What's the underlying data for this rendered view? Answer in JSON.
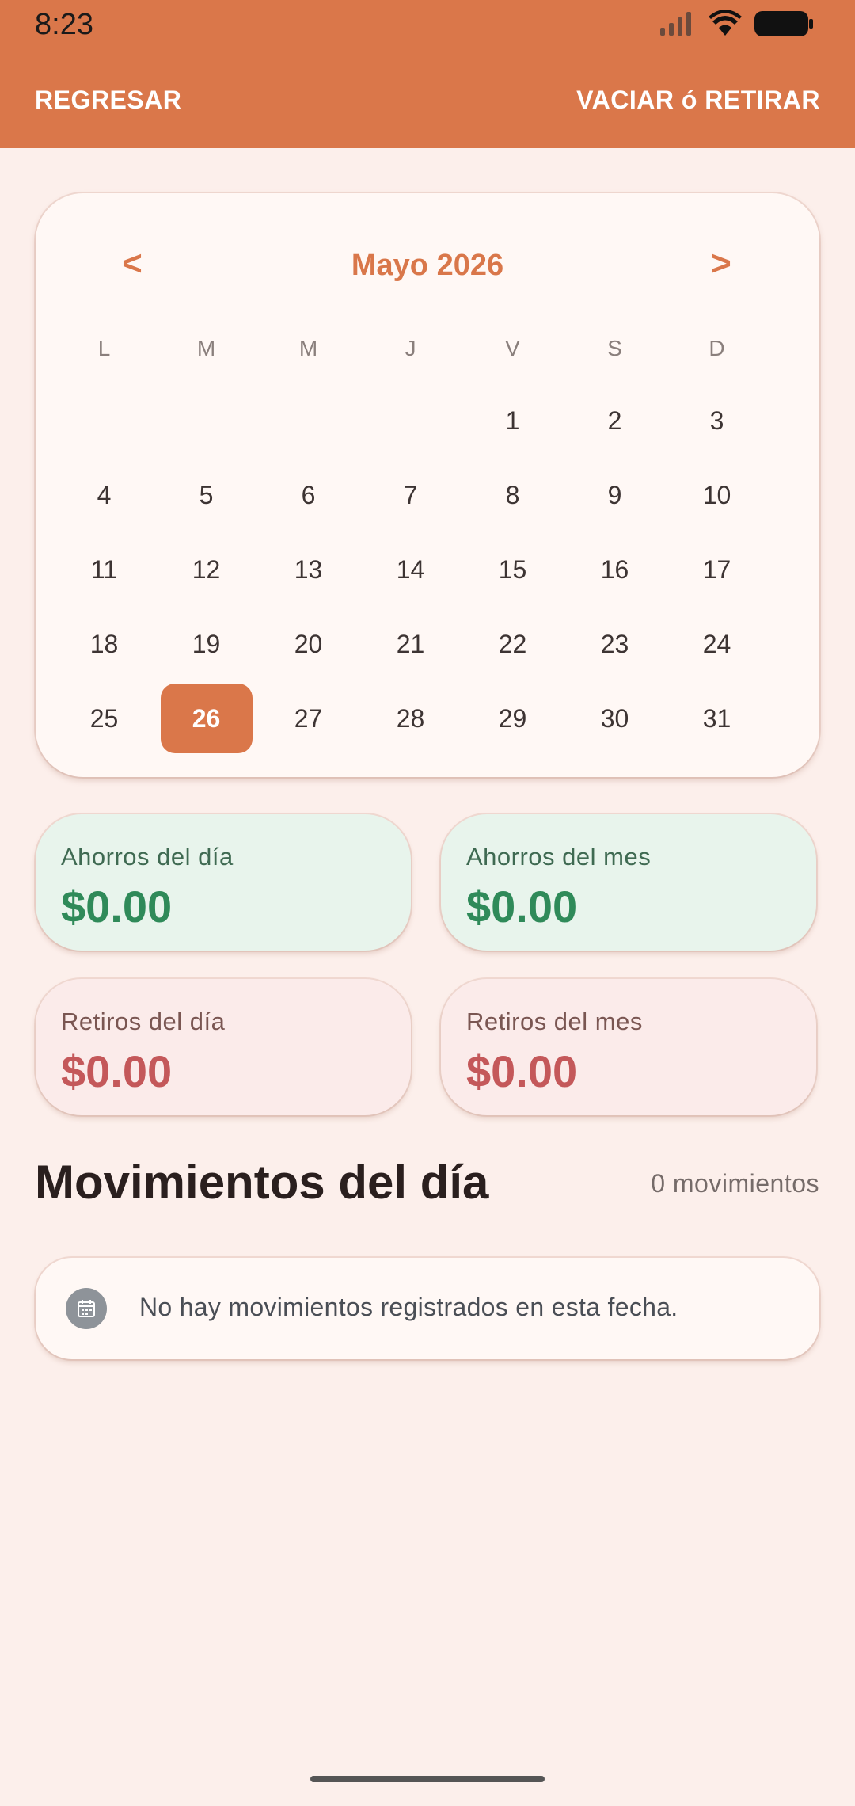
{
  "status_bar": {
    "time": "8:23"
  },
  "app_bar": {
    "back_label": "REGRESAR",
    "action_label": "VACIAR ó RETIRAR",
    "background": "#DA774A"
  },
  "calendar": {
    "prev_label": "<",
    "next_label": ">",
    "month_title": "Mayo 2026",
    "weekdays": [
      "L",
      "M",
      "M",
      "J",
      "V",
      "S",
      "D"
    ],
    "days": [
      "",
      "",
      "",
      "",
      "1",
      "2",
      "3",
      "4",
      "5",
      "6",
      "7",
      "8",
      "9",
      "10",
      "11",
      "12",
      "13",
      "14",
      "15",
      "16",
      "17",
      "18",
      "19",
      "20",
      "21",
      "22",
      "23",
      "24",
      "25",
      "26",
      "27",
      "28",
      "29",
      "30",
      "31"
    ],
    "selected_day": "26",
    "accent": "#DA774A"
  },
  "stats": {
    "savings_day": {
      "label": "Ahorros del día",
      "value": "$0.00"
    },
    "savings_month": {
      "label": "Ahorros del mes",
      "value": "$0.00"
    },
    "withdrawals_day": {
      "label": "Retiros del día",
      "value": "$0.00"
    },
    "withdrawals_month": {
      "label": "Retiros del mes",
      "value": "$0.00"
    },
    "savings_color": "#2F8A59",
    "withdrawals_color": "#C4585A"
  },
  "movements": {
    "title": "Movimientos del día",
    "count_label": "0 movimientos",
    "empty_message": "No hay movimientos registrados en esta fecha.",
    "empty_icon": "calendar-icon"
  }
}
